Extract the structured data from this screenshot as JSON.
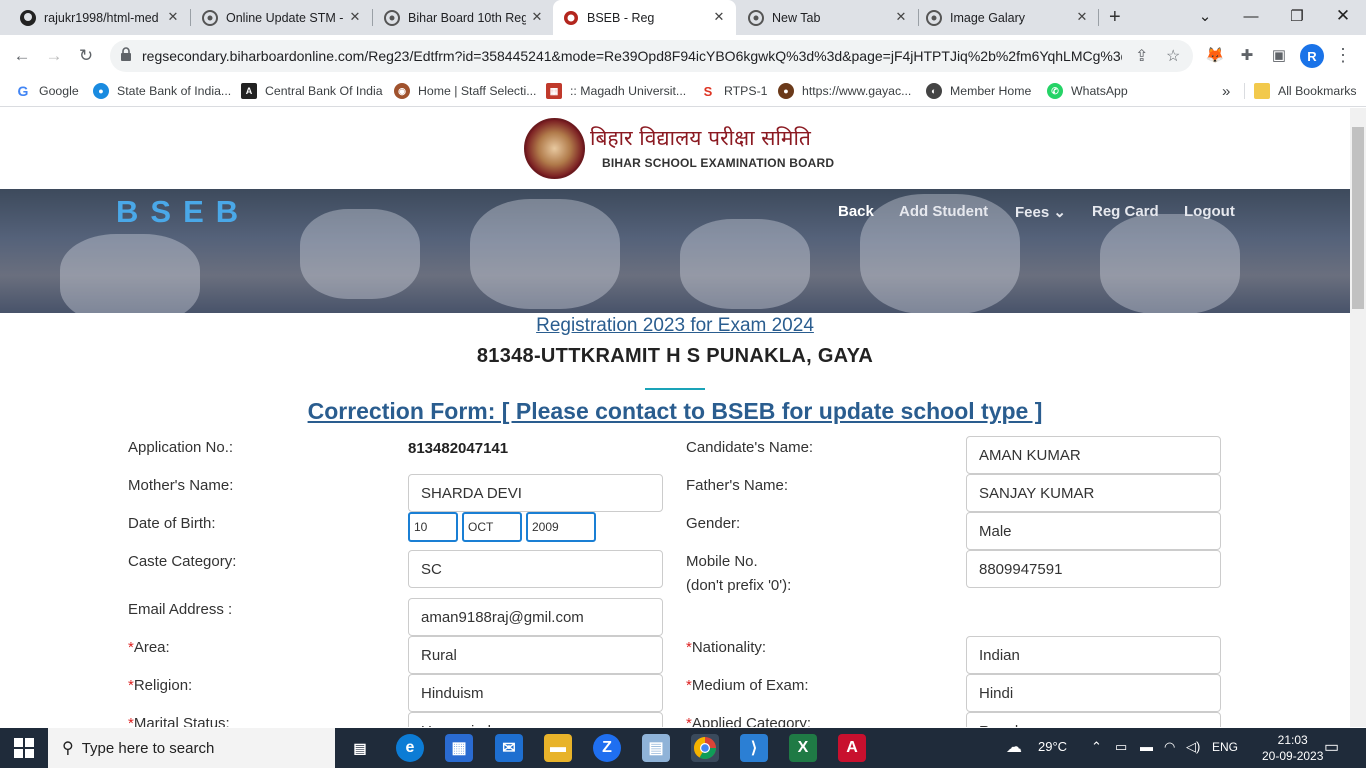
{
  "browser": {
    "tabs": [
      {
        "title": "rajukr1998/html-med",
        "icon": "github-icon"
      },
      {
        "title": "Online Update STM -",
        "icon": "chrome-icon"
      },
      {
        "title": "Bihar Board 10th Reg",
        "icon": "chrome-icon"
      },
      {
        "title": "BSEB - Reg",
        "icon": "bseb-icon",
        "active": true
      },
      {
        "title": "New Tab",
        "icon": "chrome-icon"
      },
      {
        "title": "Image Galary",
        "icon": "chrome-icon"
      }
    ],
    "url": "regsecondary.biharboardonline.com/Reg23/Edtfrm?id=358445241&mode=Re39Opd8F94icYBO6kgwkQ%3d%3d&page=jF4jHTPTJiq%2b%2fm6YqhLMCg%3d...",
    "profile_initial": "R",
    "bookmarks": [
      "Google",
      "State Bank of India...",
      "Central Bank Of India",
      "Home | Staff Selecti...",
      ":: Magadh Universit...",
      "RTPS-1",
      "https://www.gayac...",
      "Member Home",
      "WhatsApp"
    ],
    "all_bookmarks": "All Bookmarks",
    "overflow": "»"
  },
  "site": {
    "brand_hindi": "बिहार विद्यालय परीक्षा समिति",
    "brand_english": "BIHAR SCHOOL EXAMINATION BOARD",
    "logo_text": "BSEB",
    "nav": [
      "Back",
      "Add Student",
      "Fees",
      "Reg Card",
      "Logout"
    ],
    "fees_caret": "⌄"
  },
  "form": {
    "reg_title": "Registration 2023 for Exam 2024",
    "school": "81348-UTTKRAMIT H S PUNAKLA, GAYA",
    "correction_title": "Correction Form: [ Please contact to BSEB for update school type ]",
    "application_label": "Application No.:",
    "application_no": "813482047141",
    "candidate_label": "Candidate's Name:",
    "candidate_name": "AMAN KUMAR",
    "mother_label": "Mother's Name:",
    "mother_name": "SHARDA DEVI",
    "father_label": "Father's Name:",
    "father_name": "SANJAY KUMAR",
    "dob_label": "Date of Birth:",
    "dob_day": "10",
    "dob_month": "OCT",
    "dob_year": "2009",
    "gender_label": "Gender:",
    "gender": "Male",
    "caste_label": "Caste Category:",
    "caste": "SC",
    "mobile_label_1": "Mobile No.",
    "mobile_label_2": "(don't prefix '0'):",
    "mobile": "8809947591",
    "email_label": "Email Address :",
    "email": "aman9188raj@gmil.com",
    "area_label": "Area:",
    "area": "Rural",
    "nationality_label": "Nationality:",
    "nationality": "Indian",
    "religion_label": "Religion:",
    "religion": "Hinduism",
    "medium_label": "Medium of Exam:",
    "medium": "Hindi",
    "marital_label": "Marital Status:",
    "marital": "Unmarried",
    "applied_label": "Applied Category:",
    "applied": "Regular",
    "required_mark": "*"
  },
  "taskbar": {
    "search_placeholder": "Type here to search",
    "weather": "29°C",
    "language": "ENG",
    "time": "21:03",
    "date": "20-09-2023"
  }
}
